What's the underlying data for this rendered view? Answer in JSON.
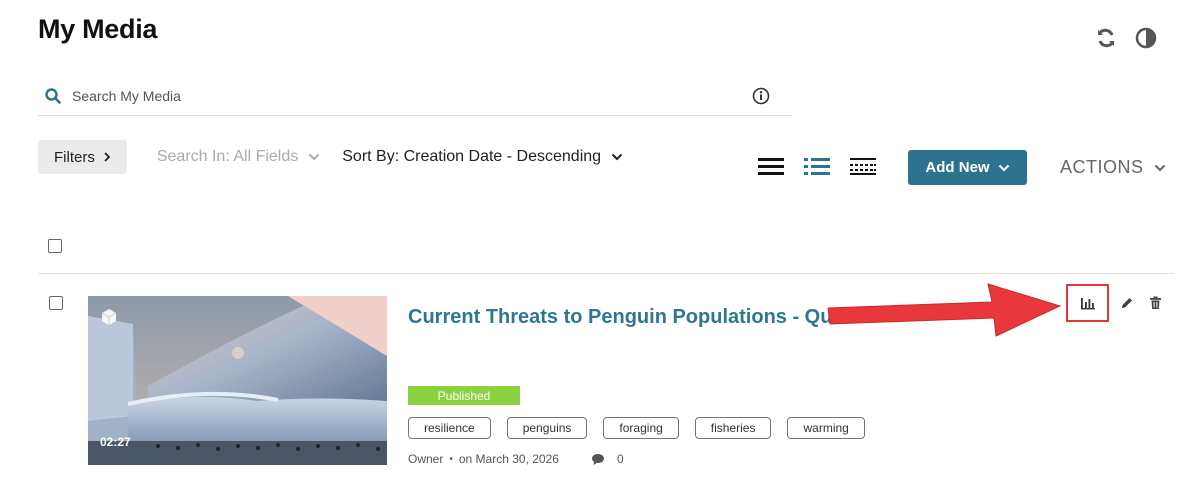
{
  "page": {
    "title": "My Media"
  },
  "top_icons": {
    "refresh": "refresh-icon",
    "contrast": "contrast-icon"
  },
  "search": {
    "placeholder": "Search My Media",
    "value": ""
  },
  "toolbar": {
    "filters_label": "Filters",
    "search_in_label": "Search In: All Fields",
    "sort_by_label": "Sort By: Creation Date - Descending"
  },
  "view_modes": [
    "details-view",
    "list-view",
    "compact-view"
  ],
  "add_new": {
    "label": "Add New"
  },
  "actions": {
    "label": "ACTIONS"
  },
  "entry": {
    "title": "Current Threats to Penguin Populations - Quiz",
    "duration": "02:27",
    "status": "Published",
    "tags": [
      "resilience",
      "penguins",
      "foraging",
      "fisheries",
      "warming"
    ],
    "owner": "Owner",
    "date": "on March 30, 2026",
    "comment_count": "0"
  },
  "colors": {
    "accent": "#2d7390",
    "title_link": "#2e7792",
    "published": "#8cd13f",
    "highlight": "#e1373b"
  }
}
